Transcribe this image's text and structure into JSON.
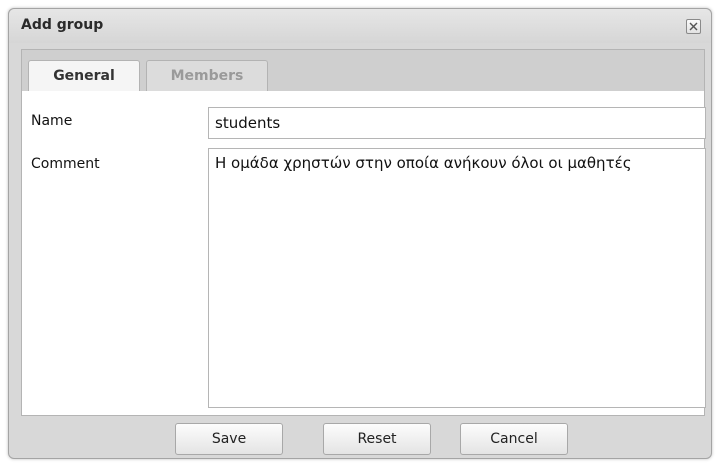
{
  "dialog": {
    "title": "Add group",
    "close_icon": "close-icon"
  },
  "tabs": [
    {
      "label": "General",
      "active": true
    },
    {
      "label": "Members",
      "active": false
    }
  ],
  "form": {
    "name_label": "Name",
    "name_value": "students",
    "comment_label": "Comment",
    "comment_value": "Η ομάδα χρηστών στην οποία ανήκουν όλοι οι μαθητές"
  },
  "buttons": {
    "save": "Save",
    "reset": "Reset",
    "cancel": "Cancel"
  },
  "colors": {
    "dialog_background": "#d8d8d8",
    "panel_background": "#ffffff",
    "inactive_tab_text": "#9a9a9a"
  }
}
